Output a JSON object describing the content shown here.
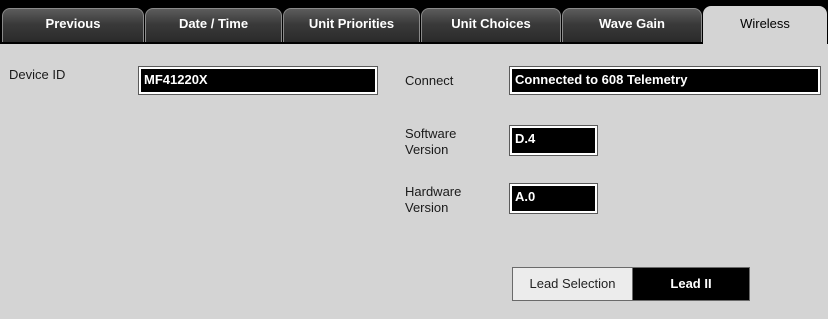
{
  "tabs": [
    {
      "label": "Previous"
    },
    {
      "label": "Date / Time"
    },
    {
      "label": "Unit Priorities"
    },
    {
      "label": "Unit Choices"
    },
    {
      "label": "Wave Gain"
    },
    {
      "label": "Wireless"
    }
  ],
  "active_tab": "Wireless",
  "device": {
    "id_label": "Device ID",
    "id_value": "MF41220X"
  },
  "connect": {
    "label": "Connect",
    "value": "Connected to 608 Telemetry"
  },
  "software": {
    "label_line1": "Software",
    "label_line2": "Version",
    "value": "D.4"
  },
  "hardware": {
    "label_line1": "Hardware",
    "label_line2": "Version",
    "value": "A.0"
  },
  "lead": {
    "label": "Lead Selection",
    "value": "Lead II"
  },
  "colors": {
    "panel_bg": "#d4d4d4",
    "field_bg": "#000000",
    "tab_bar": "#000000"
  }
}
